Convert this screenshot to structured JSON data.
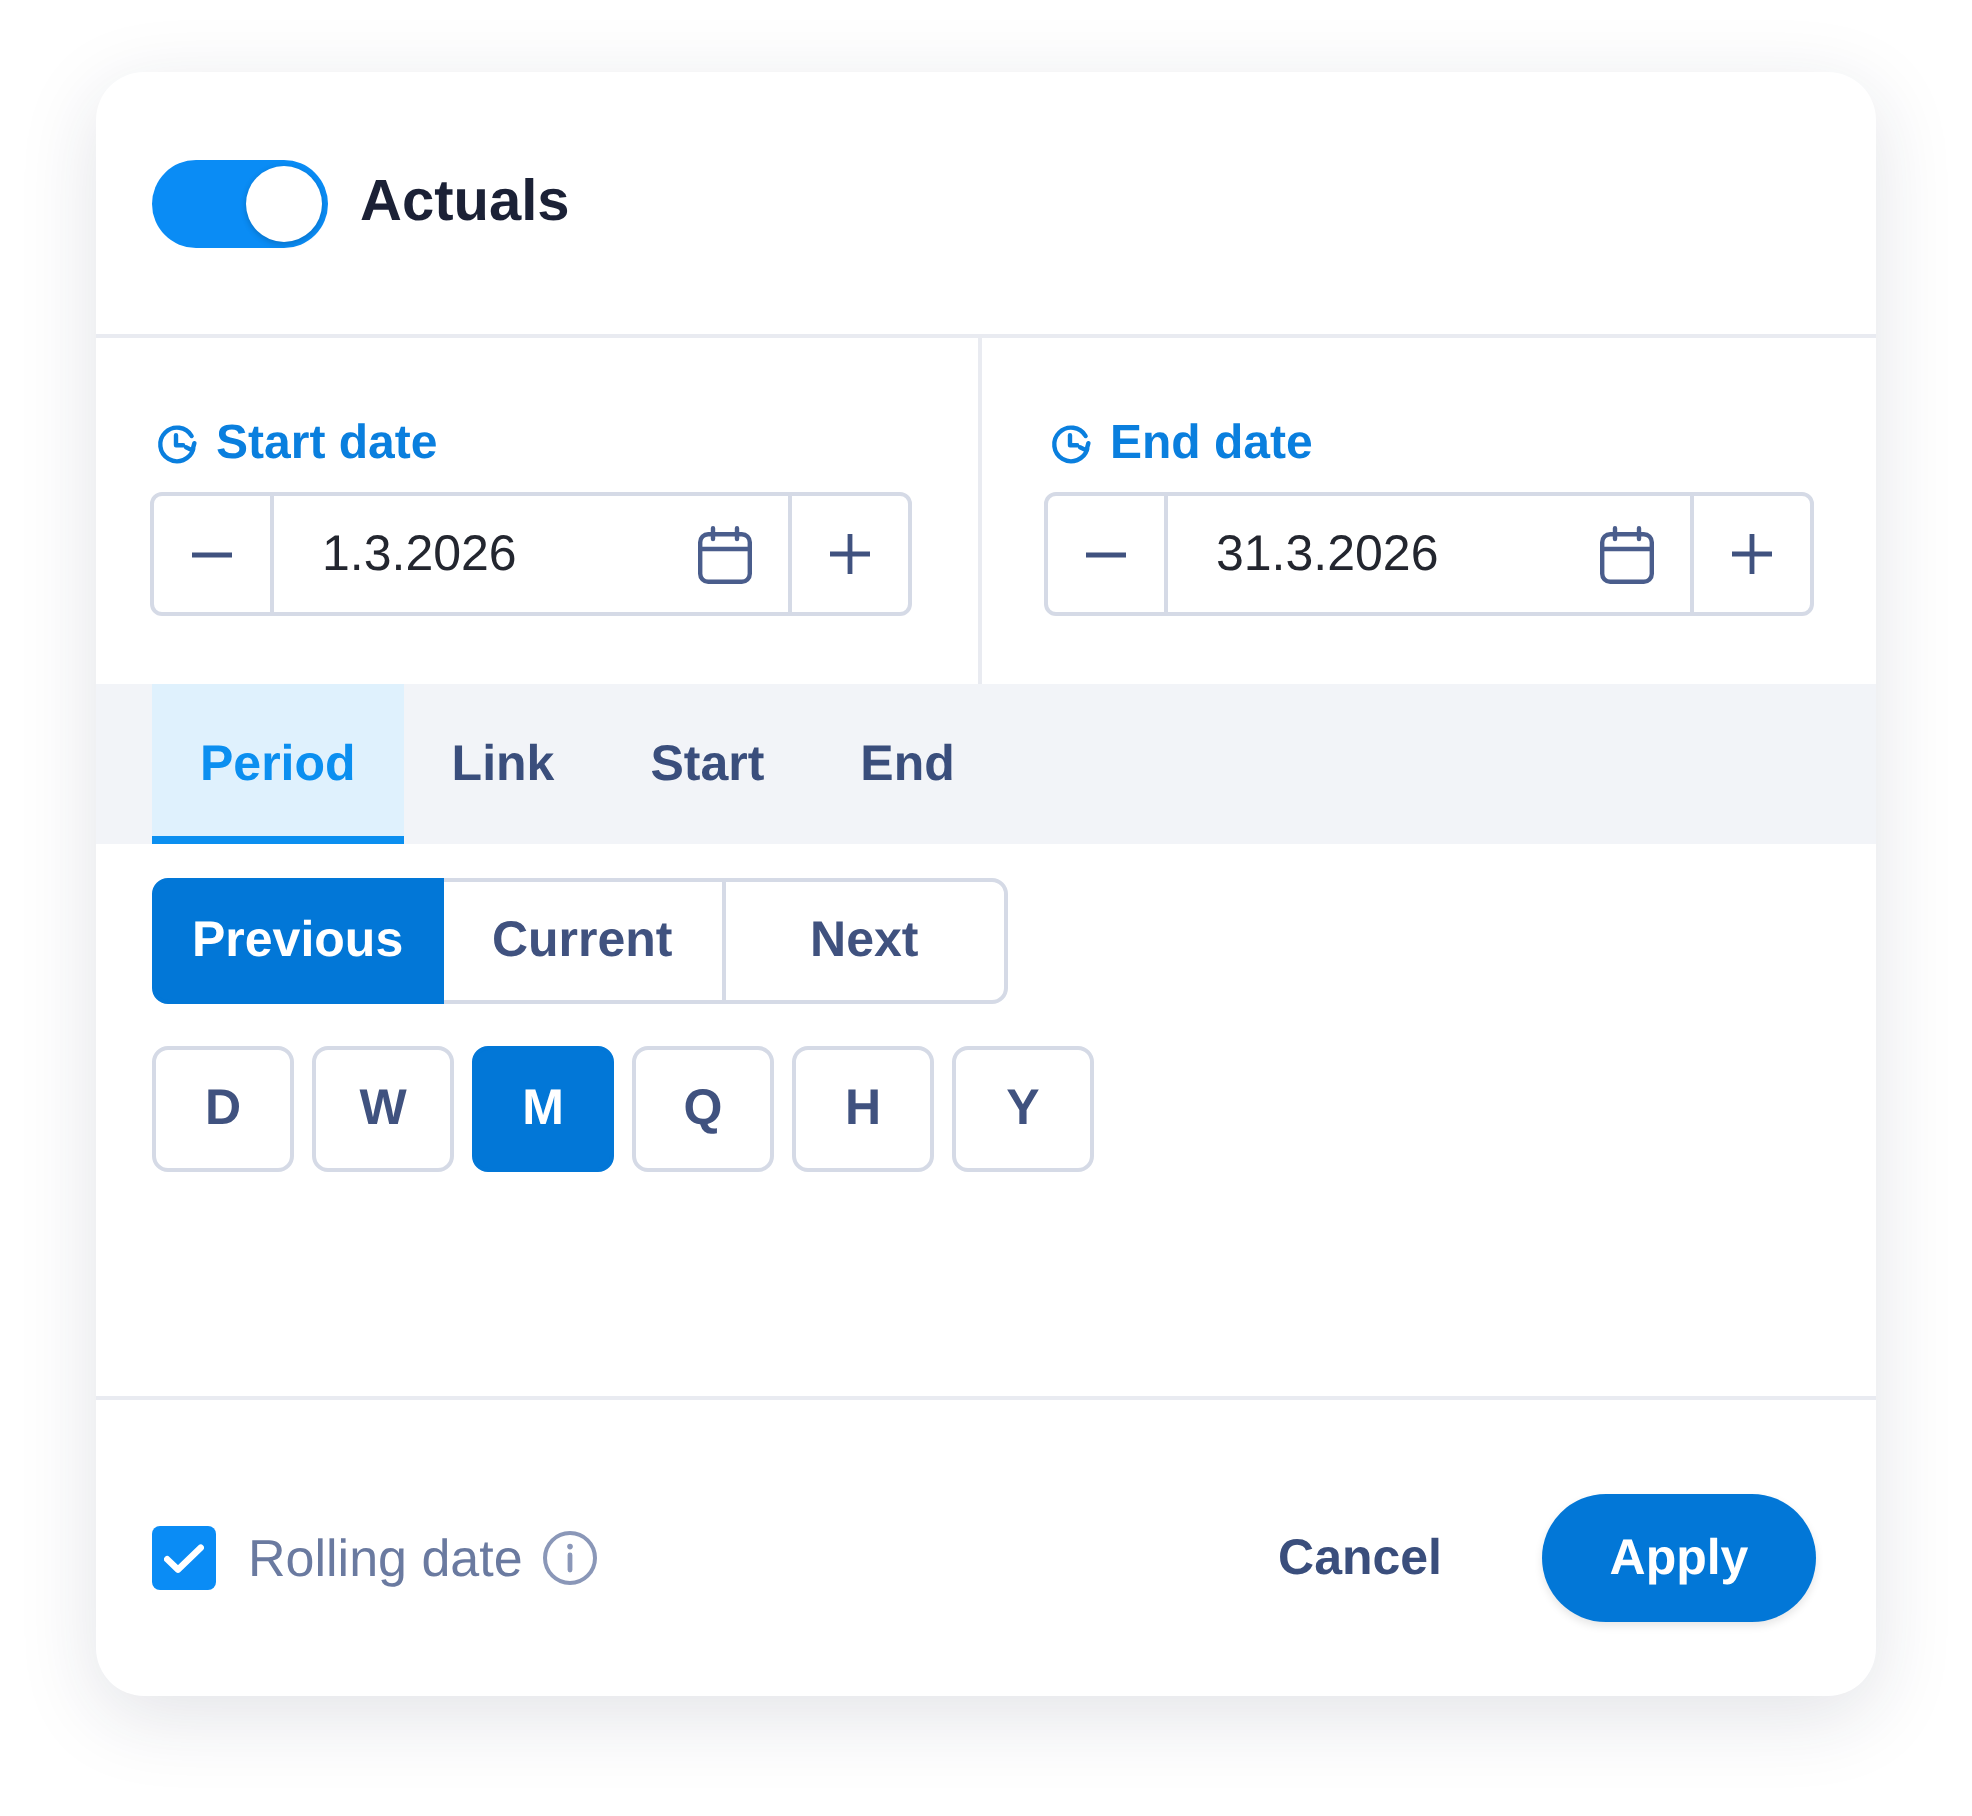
{
  "header": {
    "toggle": {
      "on": true
    },
    "title": "Actuals"
  },
  "date_fields": [
    {
      "label": "Start date",
      "value": "1.3.2026"
    },
    {
      "label": "End date",
      "value": "31.3.2026"
    }
  ],
  "tabs": [
    {
      "label": "Period",
      "selected": true
    },
    {
      "label": "Link",
      "selected": false
    },
    {
      "label": "Start",
      "selected": false
    },
    {
      "label": "End",
      "selected": false
    }
  ],
  "period_offsets": [
    {
      "label": "Previous",
      "selected": true
    },
    {
      "label": "Current",
      "selected": false
    },
    {
      "label": "Next",
      "selected": false
    }
  ],
  "units": [
    {
      "label": "D",
      "selected": false
    },
    {
      "label": "W",
      "selected": false
    },
    {
      "label": "M",
      "selected": true
    },
    {
      "label": "Q",
      "selected": false
    },
    {
      "label": "H",
      "selected": false
    },
    {
      "label": "Y",
      "selected": false
    }
  ],
  "footer": {
    "rolling_date": {
      "label": "Rolling date",
      "checked": true
    },
    "cancel": "Cancel",
    "apply": "Apply"
  }
}
